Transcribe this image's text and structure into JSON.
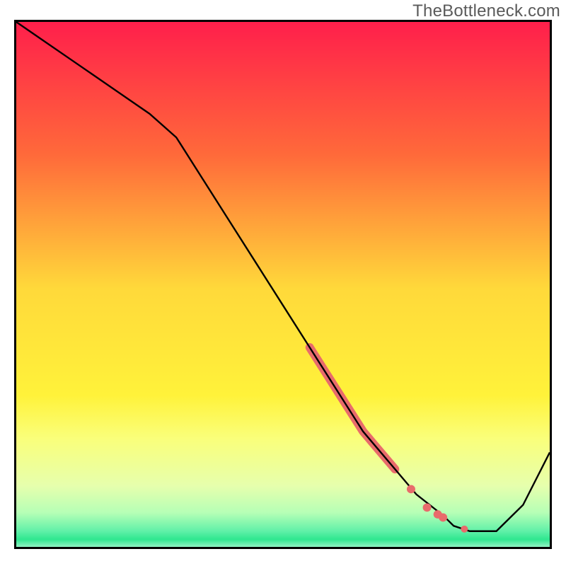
{
  "watermark": "TheBottleneck.com",
  "chart_data": {
    "type": "line",
    "title": "",
    "xlabel": "",
    "ylabel": "",
    "xlim": [
      0,
      100
    ],
    "ylim": [
      0,
      100
    ],
    "annotations": [],
    "background_gradient": {
      "stops": [
        {
          "pos": 0.0,
          "color": "#ff1f4b"
        },
        {
          "pos": 0.25,
          "color": "#ff6a3a"
        },
        {
          "pos": 0.5,
          "color": "#ffd93a"
        },
        {
          "pos": 0.7,
          "color": "#fff23a"
        },
        {
          "pos": 0.78,
          "color": "#faff7a"
        },
        {
          "pos": 0.87,
          "color": "#e6ffad"
        },
        {
          "pos": 0.92,
          "color": "#b6ffb6"
        },
        {
          "pos": 0.955,
          "color": "#5ff0a8"
        },
        {
          "pos": 0.97,
          "color": "#2fe78f"
        },
        {
          "pos": 1.0,
          "color": "#ffffff"
        }
      ]
    },
    "series": [
      {
        "name": "curve",
        "x": [
          0,
          5,
          10,
          15,
          20,
          25,
          30,
          35,
          40,
          45,
          50,
          55,
          60,
          65,
          70,
          75,
          80,
          82,
          85,
          90,
          95,
          100
        ],
        "y": [
          100,
          96.5,
          93,
          89.5,
          86,
          82.5,
          78,
          70,
          62,
          54,
          46,
          38,
          30,
          22,
          16,
          10,
          6,
          4,
          3,
          3,
          8,
          18
        ],
        "stroke": "#000000",
        "stroke_width": 2.4
      }
    ],
    "markers": {
      "name": "highlight-dots",
      "color": "#e86b6b",
      "radius": 5,
      "segment": {
        "x": [
          55,
          56,
          57,
          58,
          59,
          60,
          61,
          62,
          63,
          64,
          65,
          66,
          67,
          68,
          69,
          70,
          71
        ],
        "y": [
          38,
          36.4,
          34.8,
          33.2,
          31.6,
          30,
          28.4,
          26.8,
          25.2,
          23.6,
          22,
          20.8,
          19.6,
          18.4,
          17.2,
          16,
          14.8
        ],
        "radius": 6
      },
      "singles": [
        {
          "x": 74,
          "y": 11.0,
          "r": 6
        },
        {
          "x": 77,
          "y": 7.5,
          "r": 6
        },
        {
          "x": 79,
          "y": 6.2,
          "r": 6
        },
        {
          "x": 80,
          "y": 5.6,
          "r": 6
        },
        {
          "x": 84,
          "y": 3.4,
          "r": 5
        }
      ]
    }
  }
}
